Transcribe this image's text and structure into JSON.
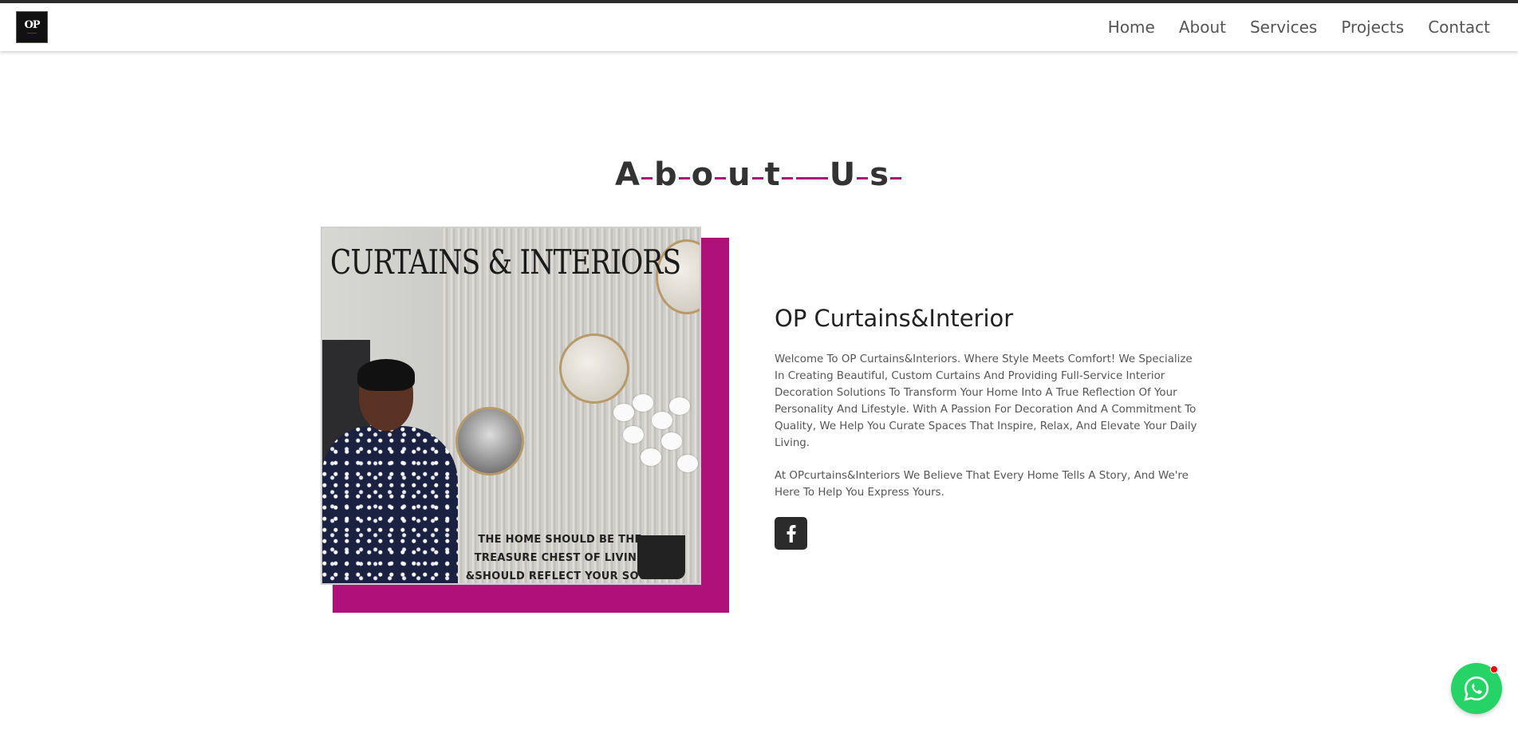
{
  "nav": {
    "logo_text": "OP",
    "items": [
      {
        "label": "Home"
      },
      {
        "label": "About"
      },
      {
        "label": "Services"
      },
      {
        "label": "Projects"
      },
      {
        "label": "Contact"
      }
    ]
  },
  "about": {
    "title": "About Us",
    "accent_color": "#b0107a",
    "image": {
      "headline": "CURTAINS & INTERIORS",
      "quote_lines": [
        "THE HOME SHOULD BE THE",
        "TREASURE CHEST OF LIVING",
        "&SHOULD REFLECT YOUR SOUL"
      ]
    },
    "company_name": "OP Curtains&Interior",
    "paragraph_1": "Welcome To OP Curtains&Interiors. Where Style Meets Comfort! We Specialize In Creating Beautiful, Custom Curtains And Providing Full-Service Interior Decoration Solutions To Transform Your Home Into A True Reflection Of Your Personality And Lifestyle. With A Passion For Decoration And A Commitment To Quality, We Help You Curate Spaces That Inspire, Relax, And Elevate Your Daily Living.",
    "paragraph_2": "At OPcurtains&Interiors We Believe That Every Home Tells A Story, And We're Here To Help You Express Yours.",
    "social_icon": "facebook-icon"
  },
  "floating": {
    "whatsapp_icon": "whatsapp-icon",
    "whatsapp_color": "#25d366"
  }
}
